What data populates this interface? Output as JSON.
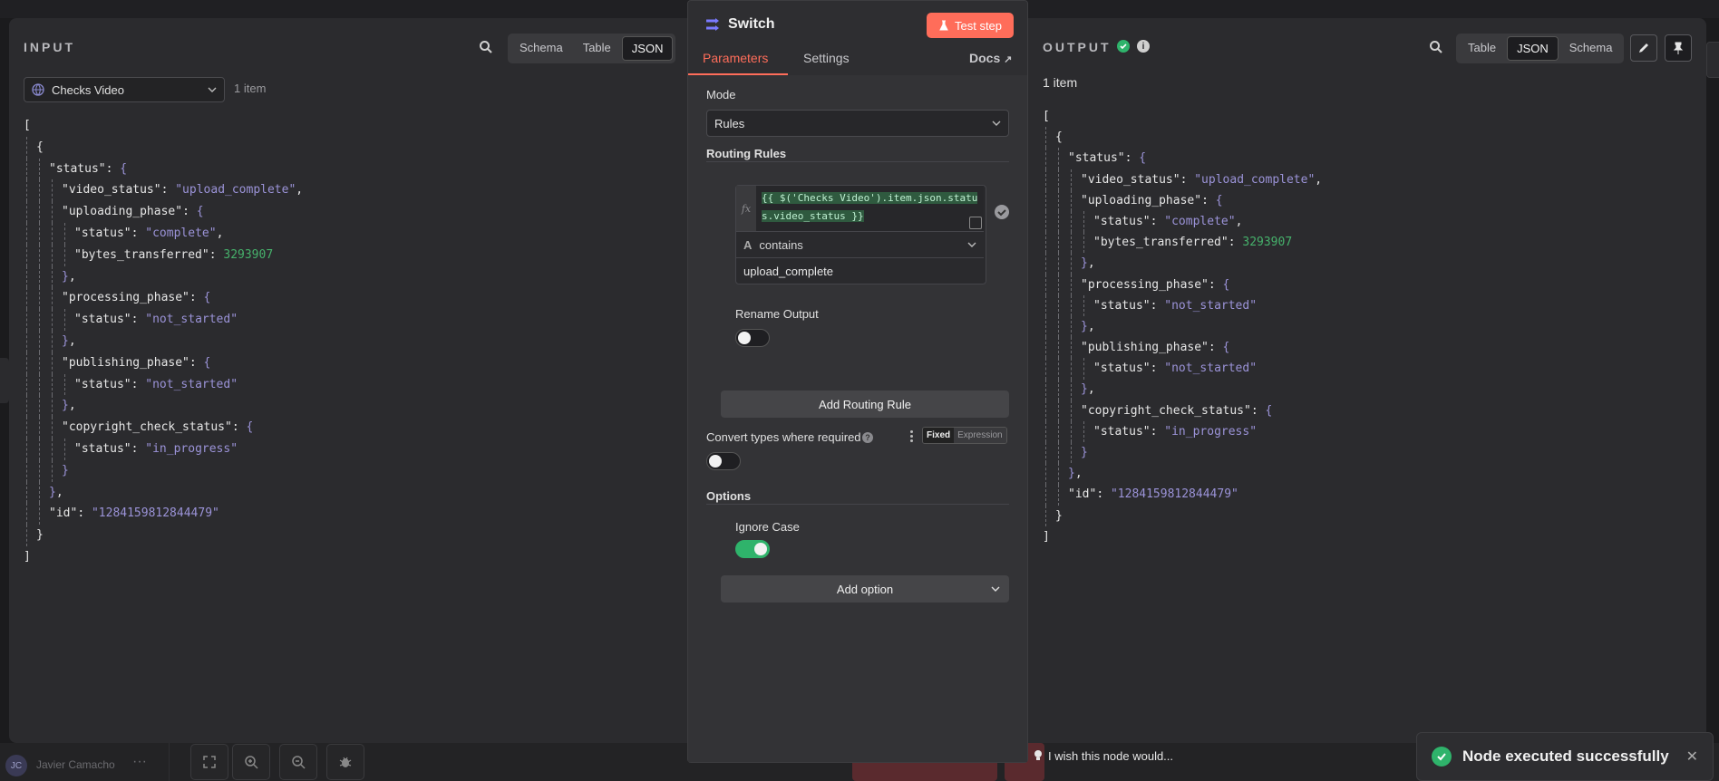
{
  "input": {
    "title": "INPUT",
    "view_modes": [
      "Schema",
      "Table",
      "JSON"
    ],
    "active_view": "JSON",
    "node_select": "Checks Video",
    "item_count": "1 item"
  },
  "output": {
    "title": "OUTPUT",
    "view_modes": [
      "Table",
      "JSON",
      "Schema"
    ],
    "active_view": "JSON",
    "item_count": "1 item"
  },
  "json_lines": [
    {
      "d": 0,
      "t": [
        [
          "b",
          "["
        ]
      ]
    },
    {
      "d": 1,
      "t": [
        [
          "b",
          "{"
        ]
      ]
    },
    {
      "d": 2,
      "t": [
        [
          "k",
          "\"status\""
        ],
        [
          "b",
          ": "
        ],
        [
          "p",
          "{"
        ]
      ]
    },
    {
      "d": 3,
      "t": [
        [
          "k",
          "\"video_status\""
        ],
        [
          "b",
          ": "
        ],
        [
          "s",
          "\"upload_complete\""
        ],
        [
          "b",
          ","
        ]
      ]
    },
    {
      "d": 3,
      "t": [
        [
          "k",
          "\"uploading_phase\""
        ],
        [
          "b",
          ": "
        ],
        [
          "p",
          "{"
        ]
      ]
    },
    {
      "d": 4,
      "t": [
        [
          "k",
          "\"status\""
        ],
        [
          "b",
          ": "
        ],
        [
          "s",
          "\"complete\""
        ],
        [
          "b",
          ","
        ]
      ]
    },
    {
      "d": 4,
      "t": [
        [
          "k",
          "\"bytes_transferred\""
        ],
        [
          "b",
          ": "
        ],
        [
          "n",
          "3293907"
        ]
      ]
    },
    {
      "d": 3,
      "t": [
        [
          "p",
          "}"
        ],
        [
          "b",
          ","
        ]
      ]
    },
    {
      "d": 3,
      "t": [
        [
          "k",
          "\"processing_phase\""
        ],
        [
          "b",
          ": "
        ],
        [
          "p",
          "{"
        ]
      ]
    },
    {
      "d": 4,
      "t": [
        [
          "k",
          "\"status\""
        ],
        [
          "b",
          ": "
        ],
        [
          "s",
          "\"not_started\""
        ]
      ]
    },
    {
      "d": 3,
      "t": [
        [
          "p",
          "}"
        ],
        [
          "b",
          ","
        ]
      ]
    },
    {
      "d": 3,
      "t": [
        [
          "k",
          "\"publishing_phase\""
        ],
        [
          "b",
          ": "
        ],
        [
          "p",
          "{"
        ]
      ]
    },
    {
      "d": 4,
      "t": [
        [
          "k",
          "\"status\""
        ],
        [
          "b",
          ": "
        ],
        [
          "s",
          "\"not_started\""
        ]
      ]
    },
    {
      "d": 3,
      "t": [
        [
          "p",
          "}"
        ],
        [
          "b",
          ","
        ]
      ]
    },
    {
      "d": 3,
      "t": [
        [
          "k",
          "\"copyright_check_status\""
        ],
        [
          "b",
          ": "
        ],
        [
          "p",
          "{"
        ]
      ]
    },
    {
      "d": 4,
      "t": [
        [
          "k",
          "\"status\""
        ],
        [
          "b",
          ": "
        ],
        [
          "s",
          "\"in_progress\""
        ]
      ]
    },
    {
      "d": 3,
      "t": [
        [
          "p",
          "}"
        ]
      ]
    },
    {
      "d": 2,
      "t": [
        [
          "p",
          "}"
        ],
        [
          "b",
          ","
        ]
      ]
    },
    {
      "d": 2,
      "t": [
        [
          "k",
          "\"id\""
        ],
        [
          "b",
          ": "
        ],
        [
          "s",
          "\"1284159812844479\""
        ]
      ]
    },
    {
      "d": 1,
      "t": [
        [
          "b",
          "}"
        ]
      ]
    },
    {
      "d": 0,
      "t": [
        [
          "b",
          "]"
        ]
      ]
    }
  ],
  "node": {
    "name": "Switch",
    "test_button": "Test step",
    "tabs": [
      "Parameters",
      "Settings"
    ],
    "docs_link": "Docs",
    "mode_label": "Mode",
    "mode_value": "Rules",
    "routing_rules_label": "Routing Rules",
    "rule_expression": "{{ $('Checks Video').item.json.status.video_status }}",
    "rule_operator": "contains",
    "rule_value": "upload_complete",
    "rename_output_label": "Rename Output",
    "add_rule_button": "Add Routing Rule",
    "convert_types_label": "Convert types where required",
    "fixed_label": "Fixed",
    "expression_label": "Expression",
    "options_label": "Options",
    "ignore_case_label": "Ignore Case",
    "add_option_button": "Add option",
    "wish_text": "I wish this node would..."
  },
  "toast": {
    "message": "Node executed successfully"
  },
  "user": {
    "initials": "JC",
    "name": "Javier Camacho"
  },
  "colors": {
    "accent": "#ff6d5a",
    "success": "#2fb36b",
    "json_string": "#9b93d8",
    "json_number": "#46b16b"
  }
}
